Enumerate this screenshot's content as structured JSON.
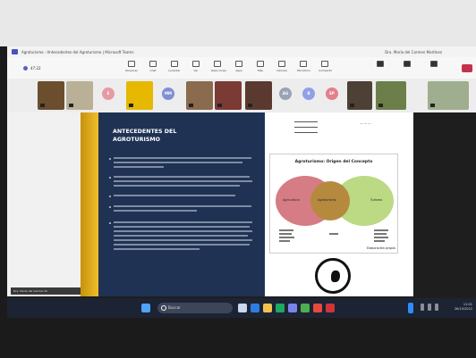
{
  "window": {
    "title": "Agroturismo - Antecedentes del Agroturismo | Microsoft Teams",
    "right_info": "Dra. María del Carmen Martínez"
  },
  "toolbar": {
    "time": "47:22",
    "buttons": [
      "Personas",
      "Chat",
      "Levantar",
      "Ver",
      "Reacciones",
      "Apps",
      "Más",
      "Cámara",
      "Micrófono",
      "Compartir"
    ],
    "leave_label": "Salir"
  },
  "participants": {
    "tiles": [
      {
        "color": "#6b4e2e",
        "type": "photo"
      },
      {
        "color": "#b9b097",
        "type": "photo"
      },
      {
        "initials": "E",
        "color": "#e79aa6",
        "type": "avatar"
      },
      {
        "color": "#e6b800",
        "type": "photo"
      },
      {
        "initials": "MM",
        "color": "#7f8fd6",
        "type": "avatar"
      },
      {
        "color": "#8a6b4d",
        "type": "photo"
      },
      {
        "color": "#7a3b35",
        "type": "photo"
      },
      {
        "color": "#5a3a30",
        "type": "photo"
      },
      {
        "initials": "AG",
        "color": "#9aa3b5",
        "type": "avatar"
      },
      {
        "initials": "B",
        "color": "#8fa0e8",
        "type": "avatar"
      },
      {
        "initials": "EP",
        "color": "#e2808b",
        "type": "avatar"
      },
      {
        "color": "#4d4035",
        "type": "photo"
      },
      {
        "color": "#6c7f4a",
        "type": "photo"
      },
      {
        "color": "#9fae8e",
        "type": "photo"
      }
    ]
  },
  "presenter_caption": "Dra. María del Carmen M.",
  "slide": {
    "title_line1": "ANTECEDENTES DEL",
    "title_line2": "AGROTURISMO",
    "diagram": {
      "title": "Agroturismo: Origen del Concepto",
      "left_label": "Agricultura",
      "center_label": "Agroturismo",
      "right_label": "Turismo",
      "footnote": "Elaboración propia"
    }
  },
  "taskbar": {
    "search_placeholder": "Buscar",
    "time": "11:01",
    "date": "26/10/2022"
  },
  "colors": {
    "slide_bg": "#1f3253",
    "accent_gold": "#e0a81b",
    "venn_left": "#cd5f69",
    "venn_right": "#b0d26e"
  }
}
